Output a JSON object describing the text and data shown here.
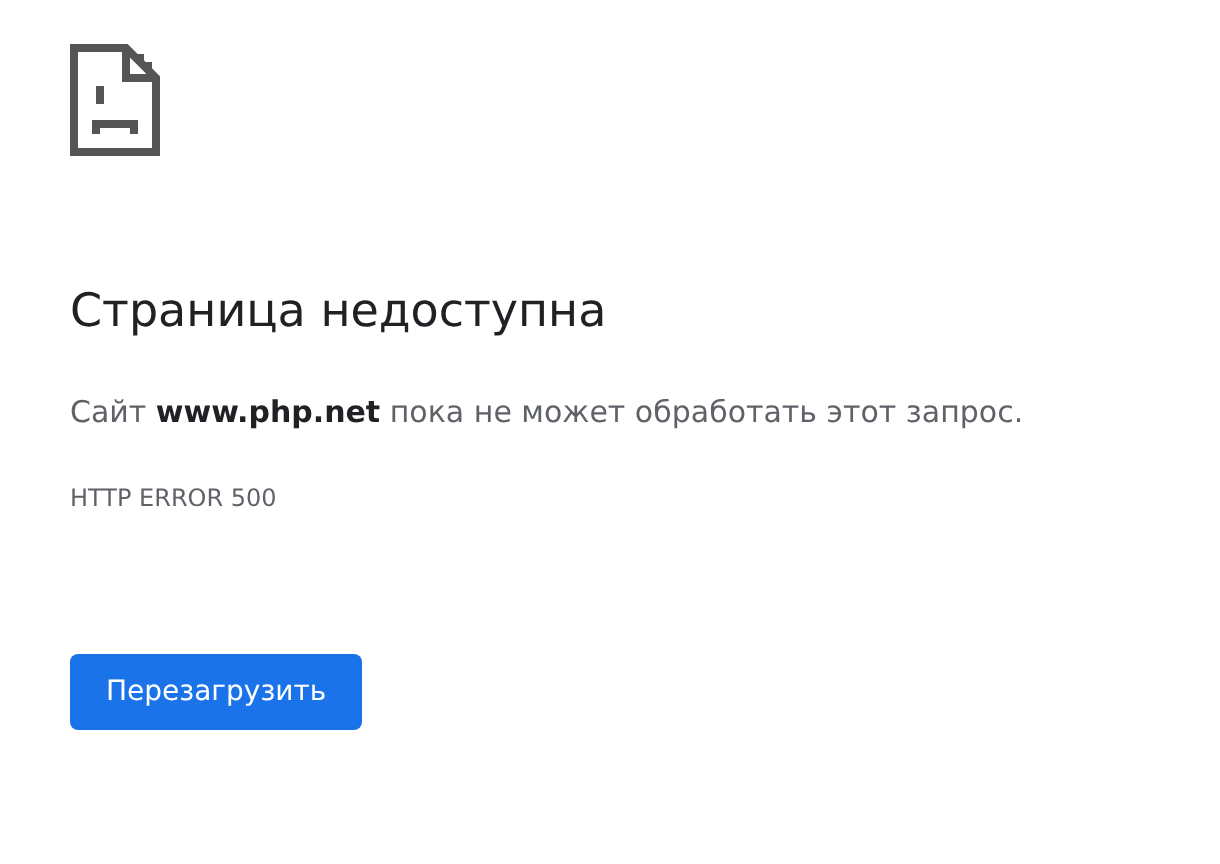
{
  "title": "Страница недоступна",
  "message": "Сайт **www.php.net** пока не может обработать этот запрос.",
  "error_code": "HTTP ERROR 500",
  "buttons": [
    "Перезагрузить"
  ]
}
